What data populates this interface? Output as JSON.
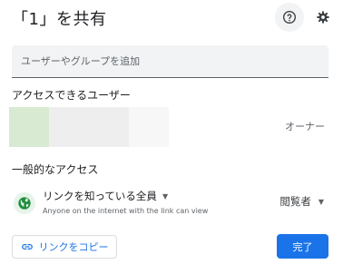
{
  "dialog": {
    "title": "「1」を共有",
    "help_icon": "help-icon",
    "settings_icon": "gear-icon"
  },
  "add_people": {
    "placeholder": "ユーザーやグループを追加"
  },
  "people_section": {
    "label": "アクセスできるユーザー",
    "owner": {
      "role": "オーナー",
      "avatar_colors": [
        "#d9ead3",
        "#eeeeee",
        "#eeeeee",
        "#f7f7f7"
      ]
    }
  },
  "general_access": {
    "label": "一般的なアクセス",
    "icon": "globe-icon",
    "accent_color": "#1e8e3e",
    "selected": "リンクを知っている全員",
    "description": "Anyone on the internet with the link can view",
    "role": "閲覧者"
  },
  "footer": {
    "copy_link_label": "リンクをコピー",
    "link_icon": "link-icon",
    "done_label": "完了",
    "accent": "#1a73e8"
  }
}
